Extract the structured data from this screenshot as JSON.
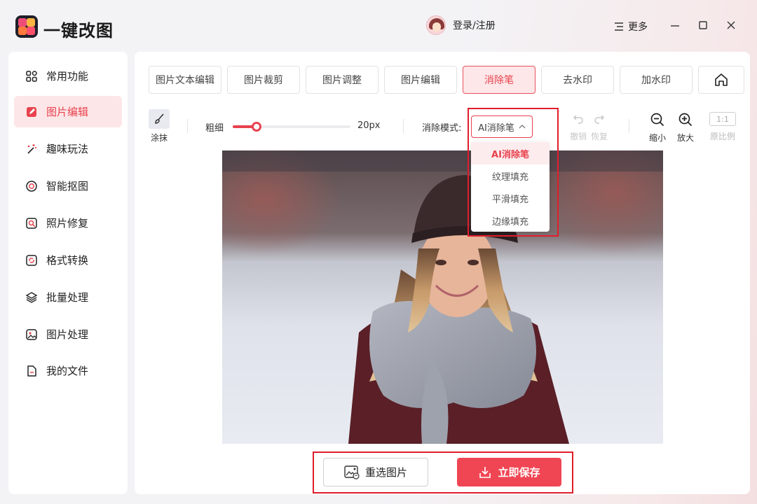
{
  "app": {
    "title": "一键改图"
  },
  "user": {
    "label": "登录/注册"
  },
  "more": {
    "label": "更多"
  },
  "sidebar": {
    "items": [
      {
        "label": "常用功能"
      },
      {
        "label": "图片编辑"
      },
      {
        "label": "趣味玩法"
      },
      {
        "label": "智能抠图"
      },
      {
        "label": "照片修复"
      },
      {
        "label": "格式转换"
      },
      {
        "label": "批量处理"
      },
      {
        "label": "图片处理"
      },
      {
        "label": "我的文件"
      }
    ]
  },
  "tabs": [
    {
      "label": "图片文本编辑"
    },
    {
      "label": "图片裁剪"
    },
    {
      "label": "图片调整"
    },
    {
      "label": "图片编辑"
    },
    {
      "label": "消除笔"
    },
    {
      "label": "去水印"
    },
    {
      "label": "加水印"
    }
  ],
  "toolbar": {
    "brush_label": "涂抹",
    "thickness_label": "粗细",
    "thickness_value": "20px",
    "thickness_fraction": 0.2,
    "mode_label": "消除模式:",
    "mode_selected": "AI消除笔",
    "mode_options": [
      "AI消除笔",
      "纹理填充",
      "平滑填充",
      "边缘填充"
    ],
    "undo_label": "撤销",
    "redo_label": "恢复",
    "zoom_out_label": "缩小",
    "zoom_in_label": "放大",
    "ratio_box": "1:1",
    "ratio_label": "原比例"
  },
  "actions": {
    "reselect_label": "重选图片",
    "save_label": "立即保存"
  },
  "colors": {
    "accent": "#e8424e",
    "highlight_box": "#e01e2b",
    "active_bg": "#fde6e7"
  }
}
